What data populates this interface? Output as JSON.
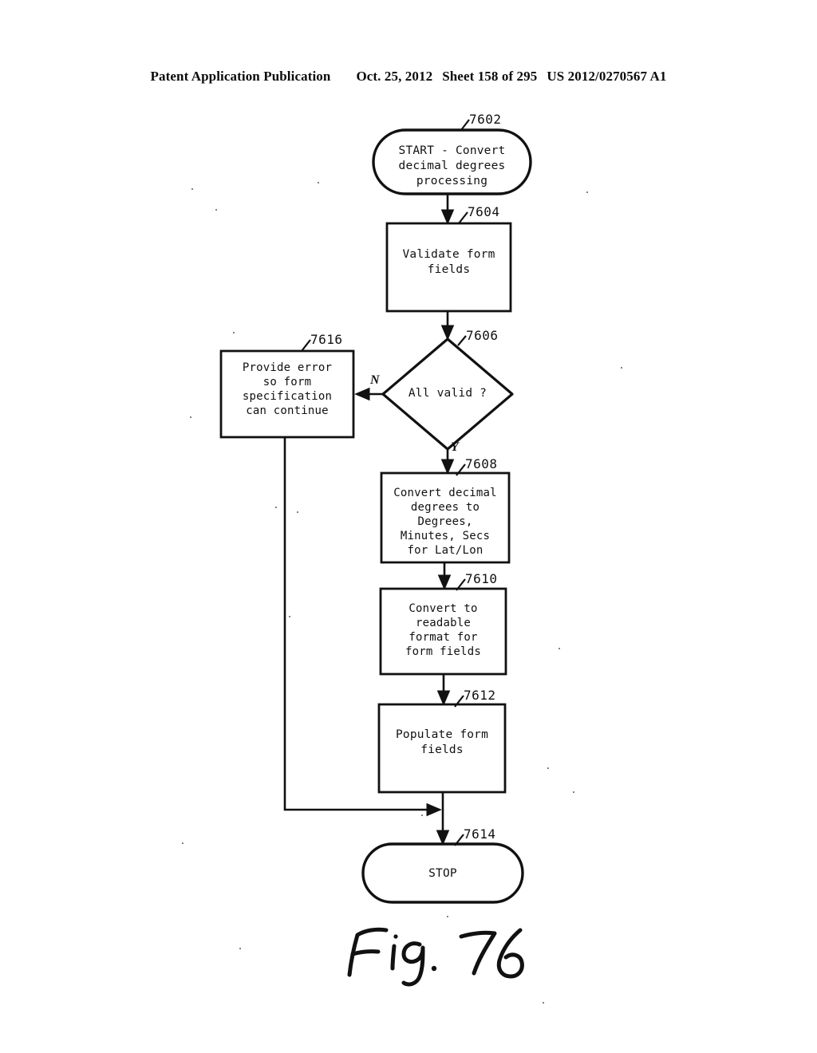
{
  "header": {
    "publication": "Patent Application Publication",
    "date": "Oct. 25, 2012",
    "sheet": "Sheet 158 of 295",
    "docnum": "US 2012/0270567 A1"
  },
  "figure": {
    "caption": "Fig. 76",
    "caption_number": "76"
  },
  "flowchart": {
    "title": "Convert decimal degrees processing",
    "nodes": [
      {
        "id": "7602",
        "ref": "7602",
        "shape": "terminator",
        "text": "START - Convert\ndecimal degrees\nprocessing"
      },
      {
        "id": "7604",
        "ref": "7604",
        "shape": "process",
        "text": "Validate form\nfields"
      },
      {
        "id": "7606",
        "ref": "7606",
        "shape": "decision",
        "text": "All valid ?"
      },
      {
        "id": "7616",
        "ref": "7616",
        "shape": "process",
        "text": "Provide error\nso form\nspecification\ncan continue"
      },
      {
        "id": "7608",
        "ref": "7608",
        "shape": "process",
        "text": "Convert decimal\ndegrees to\nDegrees,\nMinutes, Secs\nfor Lat/Lon"
      },
      {
        "id": "7610",
        "ref": "7610",
        "shape": "process",
        "text": "Convert to\nreadable\nformat for\nform fields"
      },
      {
        "id": "7612",
        "ref": "7612",
        "shape": "process",
        "text": "Populate form\nfields"
      },
      {
        "id": "7614",
        "ref": "7614",
        "shape": "terminator",
        "text": "STOP"
      }
    ],
    "branch_labels": {
      "no": "N",
      "yes": "Y"
    },
    "colors": {
      "ink": "#111111",
      "paper": "#ffffff"
    }
  }
}
